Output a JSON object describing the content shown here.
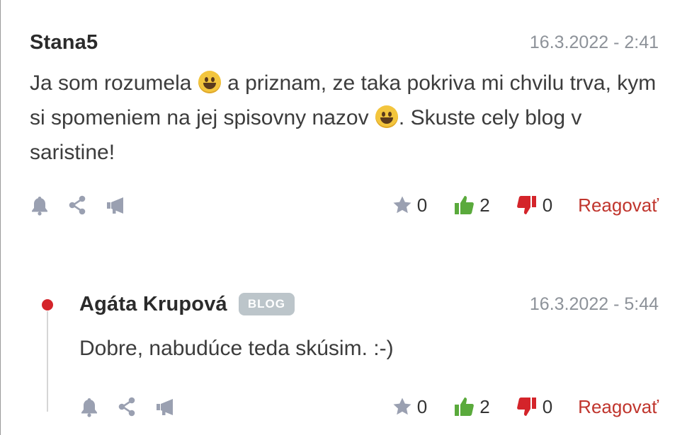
{
  "comments": [
    {
      "author": "Stana5",
      "date": "16.3.2022 - 2:41",
      "text_parts": [
        "Ja som rozumela ",
        " a priznam, ze taka pokriva mi chvilu trva, kym si spomeniem na jej spisovny nazov ",
        ". Skuste cely blog v saristine!"
      ],
      "emoji": "grinning-face-emoji",
      "stars": "0",
      "likes": "2",
      "dislikes": "0",
      "reply_label": "Reagovať"
    },
    {
      "author": "Agáta Krupová",
      "badge": "BLOG",
      "date": "16.3.2022 - 5:44",
      "text": "Dobre, nabudúce teda skúsim. :-)",
      "stars": "0",
      "likes": "2",
      "dislikes": "0",
      "reply_label": "Reagovať"
    }
  ],
  "icons": [
    "bell-icon",
    "share-icon",
    "megaphone-icon",
    "star-icon",
    "thumbs-up-icon",
    "thumbs-down-icon"
  ],
  "colors": {
    "accent_red": "#c0352d",
    "thumb_up_green": "#5aaa3c",
    "thumb_down_red": "#d4242a",
    "muted_gray": "#8d9299",
    "icon_gray": "#9aa0b1",
    "badge_gray": "#bcc5ca"
  }
}
